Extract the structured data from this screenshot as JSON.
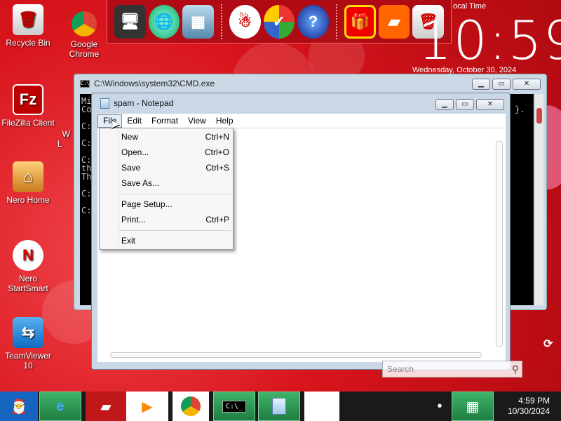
{
  "desktop": {
    "icons": [
      {
        "label": "Recycle Bin",
        "icon": "recycle-bin-icon"
      },
      {
        "label": "Google Chrome",
        "icon": "chrome-icon"
      },
      {
        "label": "FileZilla Client",
        "icon": "filezilla-icon"
      },
      {
        "label": "Nero Home",
        "icon": "nero-home-icon"
      },
      {
        "label": "Nero StartSmart",
        "icon": "nero-startsmart-icon"
      },
      {
        "label": "TeamViewer 10",
        "icon": "teamviewer-icon"
      }
    ],
    "partial_icon_label": "W\nL"
  },
  "clock_widget": {
    "label": "ocal Time",
    "time": "10:59",
    "date": "Wednesday, October 30, 2024"
  },
  "cmd_window": {
    "title": "C:\\Windows\\system32\\CMD.exe",
    "lines": [
      "Mi",
      "Co",
      "C:",
      "C:",
      "C:",
      "th",
      "Th",
      "C:",
      "C:"
    ],
    "right_fragment": "}."
  },
  "notepad": {
    "title": "spam - Notepad",
    "menu": [
      "File",
      "Edit",
      "Format",
      "View",
      "Help"
    ],
    "file_menu": [
      {
        "label": "New",
        "shortcut": "Ctrl+N"
      },
      {
        "label": "Open...",
        "shortcut": "Ctrl+O"
      },
      {
        "label": "Save",
        "shortcut": "Ctrl+S"
      },
      {
        "label": "Save As...",
        "shortcut": ""
      },
      {
        "label": "Page Setup...",
        "shortcut": ""
      },
      {
        "label": "Print...",
        "shortcut": "Ctrl+P"
      },
      {
        "label": "Exit",
        "shortcut": ""
      }
    ]
  },
  "search": {
    "placeholder": "Search"
  },
  "taskbar": {
    "time": "4:59 PM",
    "date": "10/30/2024"
  },
  "colors": {
    "desktop_red": "#d8141c",
    "taskbar": "#1a1a1a",
    "window_frame": "#c9d7e6"
  }
}
